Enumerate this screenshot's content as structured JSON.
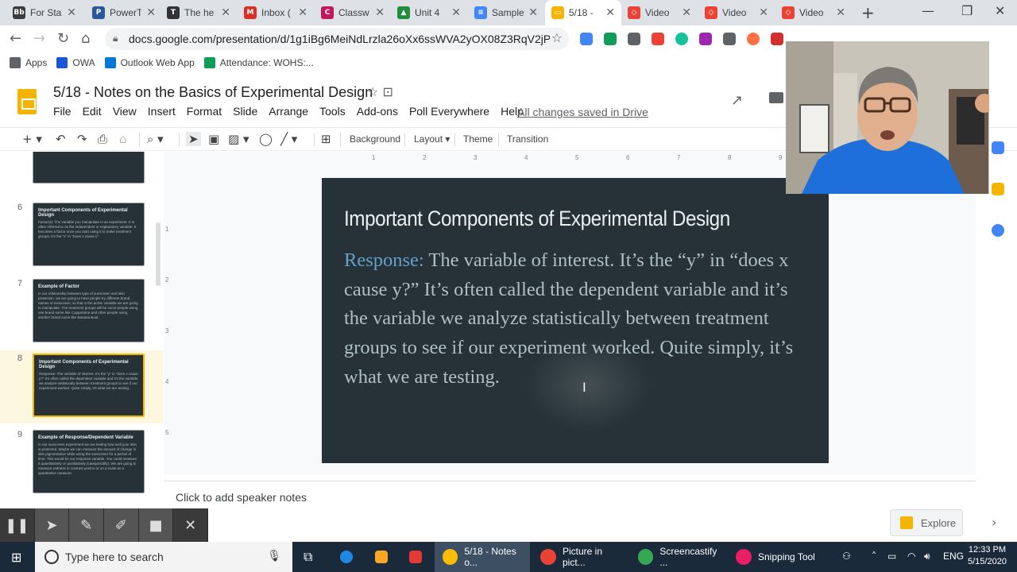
{
  "browser": {
    "tabs": [
      {
        "title": "For Sta",
        "color": "#3c3c3c",
        "glyph": "Bb"
      },
      {
        "title": "PowerT",
        "color": "#2b579a",
        "glyph": "P"
      },
      {
        "title": "The he",
        "color": "#333333",
        "glyph": "T"
      },
      {
        "title": "Inbox (",
        "color": "#d93025",
        "glyph": "M"
      },
      {
        "title": "Classw",
        "color": "#c2185b",
        "glyph": "C"
      },
      {
        "title": "Unit 4",
        "color": "#1e8e3e",
        "glyph": "▲"
      },
      {
        "title": "Sample",
        "color": "#4285f4",
        "glyph": "≡"
      },
      {
        "title": "5/18 -",
        "color": "#f4b400",
        "glyph": "▭"
      },
      {
        "title": "Video",
        "color": "#ea4335",
        "glyph": "◇"
      },
      {
        "title": "Video",
        "color": "#ea4335",
        "glyph": "◇"
      },
      {
        "title": "Video",
        "color": "#ea4335",
        "glyph": "◇"
      }
    ],
    "url": "docs.google.com/presentation/d/1g1iBg6MeiNdLrzla26oXx6ssWVA2yOX08Z3RqV2jPlg/...",
    "bookmarks": [
      {
        "label": "Apps",
        "color": "#5f6368"
      },
      {
        "label": "OWA",
        "color": "#1a56db"
      },
      {
        "label": "Outlook Web App",
        "color": "#0078d4"
      },
      {
        "label": "Attendance: WOHS:...",
        "color": "#0f9d58"
      }
    ]
  },
  "slides": {
    "doc_title": "5/18 - Notes on the Basics of Experimental Design",
    "menu": [
      "File",
      "Edit",
      "View",
      "Insert",
      "Format",
      "Slide",
      "Arrange",
      "Tools",
      "Add-ons",
      "Poll Everywhere",
      "Help"
    ],
    "save_status": "All changes saved in Drive",
    "toolbar": {
      "background": "Background",
      "layout": "Layout",
      "theme": "Theme",
      "transition": "Transition"
    },
    "filmstrip": [
      {
        "num": "",
        "title": "",
        "body": "bacteria after a series of poisoning, pick one from the test"
      },
      {
        "num": "6",
        "title": "Important Components of Experimental Design",
        "body": "Factor(s): The variable you manipulate in an experiment. It is often referred to as the independent or explanatory variable. It becomes a factor once you start using it to make treatment groups. It's the \"x\" in \"Does x cause y\""
      },
      {
        "num": "7",
        "title": "Example of Factor",
        "body": "In our relationship between type of sunscreen and skin protection, we are going to have people try different brand names of sunscreen, so that is the active variable we are going to manipulate. The treatment groups will be some people using one brand some like Coppertone and other people using another brand some like Banana Boat."
      },
      {
        "num": "8",
        "title": "Important Components of Experimental Design",
        "body": "Response: The variable of interest. It's the \"y\" in \"does x cause y?\" It's often called the dependent variable and it's the variable we analyze statistically between treatment groups to see if our experiment worked. Quite simply, it's what we are testing."
      },
      {
        "num": "9",
        "title": "Example of Response/Dependent Variable",
        "body": "In our sunscreen experiment we are testing how well your skin is protected. Maybe we can measure the amount of change in skin pigmentation while using the sunscreen for a period of time. This would be our response variable. You could measure it quantitatively or qualitatively (categorically). We are going to measure redness in contrast yes/no or on a scale as a quantitative measure."
      }
    ],
    "current_slide": {
      "title": "Important Components of Experimental Design",
      "label": "Response:",
      "body": "  The variable of interest.  It’s the “y” in “does x cause y?”  It’s often called the dependent variable and it’s the variable we analyze statistically between treatment groups to see if our experiment worked.  Quite simply, it’s what we are testing."
    },
    "speaker_notes_placeholder": "Click to add speaker notes",
    "explore": "Explore",
    "ruler_marks": [
      "1",
      "2",
      "3",
      "4",
      "5",
      "6",
      "7",
      "8",
      "9"
    ],
    "vruler_marks": [
      "1",
      "2",
      "3",
      "4",
      "5"
    ]
  },
  "taskbar": {
    "search_placeholder": "Type here to search",
    "apps": [
      {
        "label": "5/18 - Notes o...",
        "active": true
      },
      {
        "label": "Picture in pict...",
        "active": false
      },
      {
        "label": "Screencastify ...",
        "active": false
      },
      {
        "label": "Snipping Tool",
        "active": false
      }
    ],
    "lang": "ENG",
    "time": "12:33 PM",
    "date": "5/15/2020"
  }
}
